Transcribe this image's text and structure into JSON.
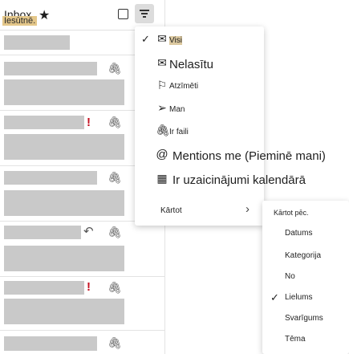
{
  "header": {
    "inbox_label": "Inbox",
    "inbox_sub": "Iesūtnē."
  },
  "filter_menu": {
    "items": [
      {
        "label": "Visi",
        "icon": "envelope-icon",
        "checked": true
      },
      {
        "label": "Nelasītu",
        "icon": "envelope-dot-icon"
      },
      {
        "label": "Atzīmēti",
        "icon": "flag-icon"
      },
      {
        "label": "Man",
        "icon": "send-icon"
      },
      {
        "label": "Ir faili",
        "icon": "paperclip-icon"
      },
      {
        "label": "Mentions me (Pieminē mani)",
        "icon": "at-icon"
      },
      {
        "label": "Ir uzaicinājumi kalendārā",
        "icon": "calendar-icon"
      }
    ],
    "sort_label": "Kārtot"
  },
  "sort_menu": {
    "title": "Kārtot pēc.",
    "items": [
      {
        "label": "Datums"
      },
      {
        "label": "Kategorija"
      },
      {
        "label": "No"
      },
      {
        "label": "Lielums",
        "checked": true
      },
      {
        "label": "Svarīgums"
      },
      {
        "label": "Tēma"
      }
    ]
  },
  "colors": {
    "flag": "#c50f1f",
    "placeholder": "#c9c9c9",
    "highlight": "#dcc9a0"
  }
}
